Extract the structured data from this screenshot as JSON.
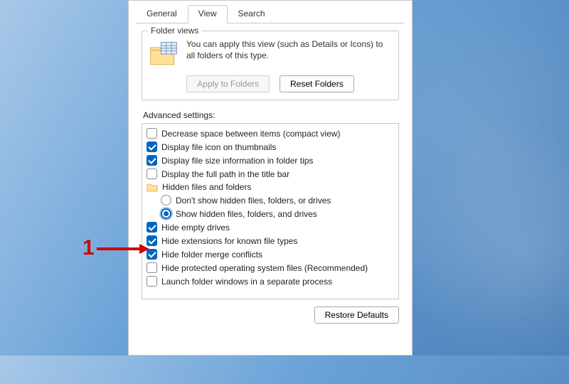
{
  "tabs": {
    "general": "General",
    "view": "View",
    "search": "Search",
    "active": "view"
  },
  "folder_views": {
    "title": "Folder views",
    "desc": "You can apply this view (such as Details or Icons) to all folders of this type.",
    "apply": "Apply to Folders",
    "reset": "Reset Folders"
  },
  "advanced": {
    "label": "Advanced settings:",
    "items": [
      {
        "kind": "check",
        "checked": false,
        "label": "Decrease space between items (compact view)"
      },
      {
        "kind": "check",
        "checked": true,
        "label": "Display file icon on thumbnails"
      },
      {
        "kind": "check",
        "checked": true,
        "label": "Display file size information in folder tips"
      },
      {
        "kind": "check",
        "checked": false,
        "label": "Display the full path in the title bar"
      },
      {
        "kind": "folder",
        "label": "Hidden files and folders"
      },
      {
        "kind": "radio",
        "selected": false,
        "indent": 1,
        "label": "Don't show hidden files, folders, or drives"
      },
      {
        "kind": "radio",
        "selected": true,
        "indent": 1,
        "focus": true,
        "label": "Show hidden files, folders, and drives"
      },
      {
        "kind": "check",
        "checked": true,
        "label": "Hide empty drives"
      },
      {
        "kind": "check",
        "checked": true,
        "label": "Hide extensions for known file types"
      },
      {
        "kind": "check",
        "checked": true,
        "label": "Hide folder merge conflicts"
      },
      {
        "kind": "check",
        "checked": false,
        "label": "Hide protected operating system files (Recommended)"
      },
      {
        "kind": "check",
        "checked": false,
        "label": "Launch folder windows in a separate process"
      }
    ],
    "restore": "Restore Defaults"
  },
  "annotation": {
    "num": "1"
  }
}
